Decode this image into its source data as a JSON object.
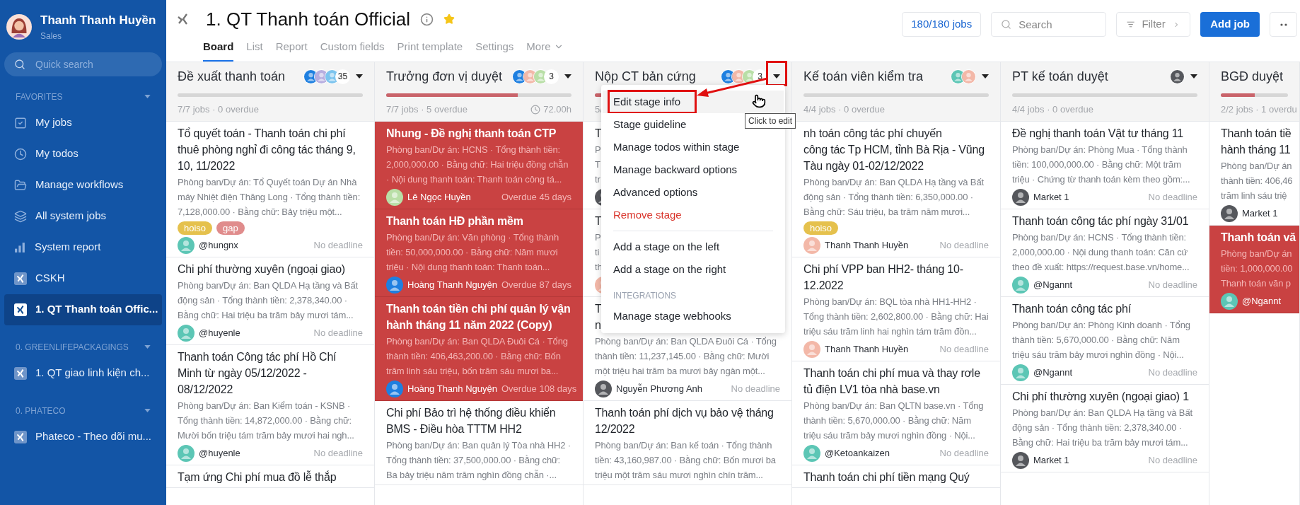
{
  "sidebar": {
    "user": {
      "name": "Thanh Thanh Huyền",
      "role": "Sales"
    },
    "search": {
      "placeholder": "Quick search"
    },
    "sections": [
      {
        "heading": "FAVORITES",
        "items": [
          {
            "label": "My jobs",
            "kind": "view",
            "selected": false
          },
          {
            "label": "My todos",
            "kind": "view",
            "selected": false
          },
          {
            "label": "Manage workflows",
            "kind": "view",
            "selected": false
          },
          {
            "label": "All system jobs",
            "kind": "view",
            "selected": false
          },
          {
            "label": "System report",
            "kind": "view",
            "selected": false
          },
          {
            "label": "CSKH",
            "kind": "workflow",
            "selected": false
          },
          {
            "label": "1. QT Thanh toán Offic...",
            "kind": "workflow",
            "selected": true
          }
        ]
      },
      {
        "heading": "0. GREENLIFEPACKAGINGS",
        "items": [
          {
            "label": "1. QT giao linh kiện ch...",
            "kind": "workflow",
            "selected": false
          }
        ]
      },
      {
        "heading": "0. PHATECO",
        "items": [
          {
            "label": "Phateco - Theo dõi mu...",
            "kind": "workflow",
            "selected": false
          }
        ]
      }
    ]
  },
  "header": {
    "title": "1. QT Thanh toán Official",
    "starred": true,
    "tabs": [
      {
        "label": "Board",
        "selected": true
      },
      {
        "label": "List",
        "selected": false
      },
      {
        "label": "Report",
        "selected": false
      },
      {
        "label": "Custom fields",
        "selected": false
      },
      {
        "label": "Print template",
        "selected": false
      },
      {
        "label": "Settings",
        "selected": false
      },
      {
        "label": "More",
        "selected": false
      }
    ],
    "jobs_count": "180/180 jobs",
    "search": {
      "placeholder": "Search"
    },
    "filter": "Filter",
    "add_button": "Add job"
  },
  "columns": [
    {
      "title": "Đề xuất thanh toán",
      "avatars": [
        {
          "color": "#1e7fe0"
        },
        {
          "color": "#b7aee0"
        },
        {
          "color": "#7cc4ee"
        }
      ],
      "count": "35",
      "level": 0,
      "stats": "7/7 jobs · 0 overdue",
      "annotated": false,
      "cards": [
        {
          "title": "Tổ quyết toán - Thanh toán chi phí thuê phòng nghỉ đi công tác tháng 9, 10, 11/2022",
          "desc": "Phòng ban/Dự án: Tổ Quyết toán Dự án Nhà máy Nhiệt điện Thăng Long · Tổng thành tiền: 7,128,000.00 · Bằng chữ: Bảy triệu một...",
          "tags": [
            {
              "label": "hoiso",
              "color": "#e5c14d"
            },
            {
              "label": "gap",
              "color": "#e08c8c"
            }
          ],
          "avatar": {
            "color": "#5cc6b5"
          },
          "assignee": "@hungnx",
          "due": "No deadline",
          "overdue": false
        },
        {
          "title": "Chi phí thường xuyên (ngoại giao)",
          "desc": "Phòng ban/Dự án: Ban QLDA Hạ tầng và Bất động sản · Tổng thành tiền: 2,378,340.00 · Bằng chữ: Hai triệu ba trăm bảy mươi tám...",
          "avatar": {
            "color": "#5cc6b5"
          },
          "assignee": "@huyenle",
          "due": "No deadline",
          "overdue": false
        },
        {
          "title": "Thanh toán Công tác phí Hồ Chí Minh từ ngày 05/12/2022 - 08/12/2022",
          "desc": "Phòng ban/Dự án: Ban Kiểm toán - KSNB · Tổng thành tiền: 14,872,000.00 · Bằng chữ: Mười bốn triệu tám trăm bảy mươi hai ngh...",
          "avatar": {
            "color": "#5cc6b5"
          },
          "assignee": "@huyenle",
          "due": "No deadline",
          "overdue": false
        },
        {
          "title": "Tạm ứng Chi phí mua đồ lễ thắp",
          "overdue": false
        }
      ]
    },
    {
      "title": "Trưởng đơn vị duyệt",
      "avatars": [
        {
          "color": "#1e7fe0"
        },
        {
          "color": "#f3b8a8"
        },
        {
          "color": "#b9dfa7"
        }
      ],
      "count": "3",
      "level": 0.71,
      "stats": "7/7 jobs · 5 overdue",
      "timer": "72.00h",
      "annotated": false,
      "cards": [
        {
          "title": "Nhung - Đề nghị thanh toán CTP",
          "desc": "Phòng ban/Dự án: HCNS · Tổng thành tiền: 2,000,000.00 · Bằng chữ: Hai triệu đồng chẵn · Nội dung thanh toán: Thanh toán công tá...",
          "avatar": {
            "color": "#b9dfa7"
          },
          "assignee": "Lê Ngọc Huyền",
          "due": "Overdue 45 days",
          "overdue": true
        },
        {
          "title": "Thanh toán HĐ phần mềm",
          "desc": "Phòng ban/Dự án: Văn phòng · Tổng thành tiền: 50,000,000.00 · Bằng chữ: Năm mươi triệu · Nội dung thanh toán: Thanh toán...",
          "avatar": {
            "color": "#1e7fe0"
          },
          "assignee": "Hoàng Thanh Nguyện",
          "due": "Overdue 87 days",
          "overdue": true
        },
        {
          "title": "Thanh toán tiền chi phí quản lý vận hành tháng 11 năm 2022 (Copy)",
          "desc": "Phòng ban/Dự án: Ban QLDA Đuôi Cá · Tổng thành tiền: 406,463,200.00 · Bằng chữ: Bốn trăm linh sáu triệu, bốn trăm sáu mươi ba...",
          "avatar": {
            "color": "#1e7fe0"
          },
          "assignee": "Hoàng Thanh Nguyện",
          "due": "Overdue 108 days",
          "overdue": true
        },
        {
          "title": "Chi phí Bảo trì hệ thống điều khiển BMS - Điều hòa TTTM HH2",
          "desc": "Phòng ban/Dự án: Ban quản lý Tòa nhà HH2 · Tổng thành tiền: 37,500,000.00 · Bằng chữ: Ba bảy triệu năm trăm nghìn đồng chẵn ·...",
          "overdue": false
        }
      ]
    },
    {
      "title": "Nộp CT bản cứng",
      "avatars": [
        {
          "color": "#1e7fe0"
        },
        {
          "color": "#f3b8a8"
        },
        {
          "color": "#b9dfa7"
        }
      ],
      "count": "3",
      "level": 0.1,
      "stats": "5/",
      "annotated": true,
      "cards": [
        {
          "title_lines": [
            "T"
          ],
          "desc_lines": [
            "P",
            "T",
            "tr"
          ],
          "avatar": {
            "color": "#55575c"
          },
          "overdue": false
        },
        {
          "title_lines": [
            "T"
          ],
          "desc_lines": [
            "P",
            "ti",
            "th"
          ],
          "avatar": {
            "color": "#f3b8a8"
          },
          "overdue": false
        },
        {
          "title_lines": [
            "T",
            "n"
          ],
          "desc": "Phòng ban/Dự án: Ban QLDA Đuôi Cá · Tổng thành tiền: 11,237,145.00 · Bằng chữ: Mười một triệu hai trăm ba mươi bảy ngàn một...",
          "avatar": {
            "color": "#55575c"
          },
          "assignee": "Nguyễn Phương Anh",
          "due": "No deadline",
          "overdue": false
        },
        {
          "title": "Thanh toán phí dịch vụ bảo vệ tháng 12/2022",
          "desc": "Phòng ban/Dự án: Ban kế toán · Tổng thành tiền: 43,160,987.00 · Bằng chữ: Bốn mươi ba triệu một trăm sáu mươi nghìn chín trăm...",
          "overdue": false
        }
      ]
    },
    {
      "title": "Kế toán viên kiểm tra",
      "avatars": [
        {
          "color": "#5cc6b5"
        },
        {
          "color": "#f3b8a8"
        }
      ],
      "level": 0,
      "stats": "4/4 jobs · 0 overdue",
      "annotated": false,
      "cards": [
        {
          "title_lines": [
            "nh toán công tác phí chuyến",
            "công tác Tp HCM, tỉnh Bà Rịa - Vũng",
            "Tàu ngày 01-02/12/2022"
          ],
          "desc": "Phòng ban/Dự án: Ban QLDA Hạ tầng và Bất động sản · Tổng thành tiền: 6,350,000.00 · Bằng chữ: Sáu triệu, ba trăm năm mươi...",
          "tags": [
            {
              "label": "hoiso",
              "color": "#e5c14d"
            }
          ],
          "avatar": {
            "color": "#f3b8a8"
          },
          "assignee": "Thanh Thanh Huyền",
          "due": "No deadline",
          "overdue": false
        },
        {
          "title": "Chi phí VPP ban HH2- tháng 10-12.2022",
          "desc": "Phòng ban/Dự án: BQL tòa nhà HH1-HH2 · Tổng thành tiền: 2,602,800.00 · Bằng chữ: Hai triệu sáu trăm linh hai nghìn tám trăm đồn...",
          "avatar": {
            "color": "#f3b8a8"
          },
          "assignee": "Thanh Thanh Huyền",
          "due": "No deadline",
          "overdue": false
        },
        {
          "title": "Thanh toán chi phí mua và thay rơle tủ điện LV1 tòa nhà base.vn",
          "desc": "Phòng ban/Dự án: Ban QLTN base.vn · Tổng thành tiền: 5,670,000.00 · Bằng chữ: Năm triệu sáu trăm bảy mươi nghìn đồng · Nội...",
          "avatar": {
            "color": "#5cc6b5"
          },
          "assignee": "@Ketoankaizen",
          "due": "No deadline",
          "overdue": false
        },
        {
          "title": "Thanh toán chi phí tiền mạng Quý",
          "overdue": false
        }
      ]
    },
    {
      "title": "PT kế toán duyệt",
      "avatars": [
        {
          "color": "#55575c"
        }
      ],
      "level": 0,
      "stats": "4/4 jobs · 0 overdue",
      "annotated": false,
      "cards": [
        {
          "title": "Đề nghị thanh toán Vật tư tháng 11",
          "desc": "Phòng ban/Dự án: Phòng Mua · Tổng thành tiền: 100,000,000.00 · Bằng chữ: Một trăm triệu · Chứng từ thanh toán kèm theo gồm:...",
          "avatar": {
            "color": "#55575c"
          },
          "assignee": "Market 1",
          "due": "No deadline",
          "overdue": false
        },
        {
          "title": "Thanh toán công tác phí ngày 31/01",
          "desc": "Phòng ban/Dự án: HCNS · Tổng thành tiền: 2,000,000.00 · Nội dung thanh toán: Căn cứ theo đề xuất: https://request.base.vn/home...",
          "avatar": {
            "color": "#5cc6b5"
          },
          "assignee": "@Ngannt",
          "due": "No deadline",
          "overdue": false
        },
        {
          "title": "Thanh toán công tác phí",
          "desc": "Phòng ban/Dự án: Phòng Kinh doanh · Tổng thành tiền: 5,670,000.00 · Bằng chữ: Năm triệu sáu trăm bảy mươi nghìn đồng · Nội...",
          "avatar": {
            "color": "#5cc6b5"
          },
          "assignee": "@Ngannt",
          "due": "No deadline",
          "overdue": false
        },
        {
          "title": "Chi phí thường xuyên (ngoại giao) 1",
          "desc": "Phòng ban/Dự án: Ban QLDA Hạ tầng và Bất động sản · Tổng thành tiền: 2,378,340.00 · Bằng chữ: Hai triệu ba trăm bảy mươi tám...",
          "avatar": {
            "color": "#55575c"
          },
          "assignee": "Market 1",
          "due": "No deadline",
          "overdue": false
        }
      ]
    },
    {
      "title": "BGĐ duyệt",
      "level": 0.5,
      "stats": "2/2 jobs · 1 overdu",
      "cards": [
        {
          "title_lines": [
            "Thanh toán tiề",
            "hành tháng 11"
          ],
          "desc_lines": [
            "Phòng ban/Dự án",
            "thành tiền: 406,46",
            "trăm linh sáu triệ"
          ],
          "avatar": {
            "color": "#55575c"
          },
          "assignee": "Market 1",
          "overdue": false
        },
        {
          "title_lines": [
            "Thanh toán vă"
          ],
          "desc_lines": [
            "Phòng ban/Dự án",
            "tiền: 1,000,000.00",
            "Thanh toán văn p"
          ],
          "avatar": {
            "color": "#5cc6b5"
          },
          "assignee": "@Ngannt",
          "overdue": true
        }
      ]
    }
  ],
  "stage_menu": {
    "items": [
      {
        "kind": "item",
        "label": "Edit stage info",
        "hovered": true,
        "annotated": true
      },
      {
        "kind": "item",
        "label": "Stage guideline",
        "hovered": false,
        "annotated": false
      },
      {
        "kind": "item",
        "label": "Manage todos within stage",
        "hovered": false,
        "annotated": false
      },
      {
        "kind": "item",
        "label": "Manage backward options",
        "hovered": false,
        "annotated": false
      },
      {
        "kind": "item",
        "label": "Advanced options",
        "hovered": false,
        "annotated": false
      },
      {
        "kind": "danger",
        "label": "Remove stage",
        "hovered": false,
        "annotated": false
      },
      {
        "kind": "divider"
      },
      {
        "kind": "item",
        "label": "Add a stage on the left",
        "hovered": false,
        "annotated": false
      },
      {
        "kind": "item",
        "label": "Add a stage on the right",
        "hovered": false,
        "annotated": false
      },
      {
        "kind": "heading",
        "label": "INTEGRATIONS"
      },
      {
        "kind": "item",
        "label": "Manage stage webhooks",
        "hovered": false,
        "annotated": false
      }
    ]
  },
  "tooltip": "Click to edit"
}
